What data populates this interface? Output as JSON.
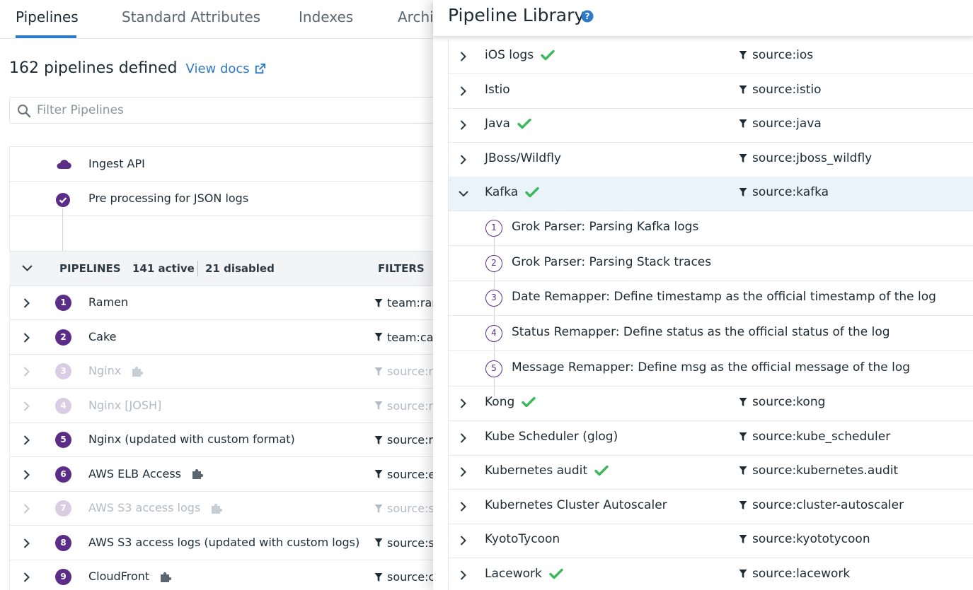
{
  "tabs": [
    {
      "label": "Pipelines",
      "active": true
    },
    {
      "label": "Standard Attributes",
      "active": false
    },
    {
      "label": "Indexes",
      "active": false
    },
    {
      "label": "Archi",
      "active": false
    }
  ],
  "summary": {
    "title": "162 pipelines defined",
    "docs_link": "View docs"
  },
  "filter": {
    "placeholder": "Filter Pipelines"
  },
  "preprocessing": [
    {
      "label": "Ingest API",
      "icon": "cloud-icon"
    },
    {
      "label": "Pre processing for JSON logs",
      "icon": "check-circle-icon"
    }
  ],
  "pipelines_header": {
    "title": "PIPELINES",
    "active": "141 active",
    "disabled": "21 disabled",
    "filters": "FILTERS"
  },
  "pipelines": [
    {
      "num": "1",
      "name": "Ramen",
      "filter": "team:ran",
      "disabled": false,
      "integration": false
    },
    {
      "num": "2",
      "name": "Cake",
      "filter": "team:cak",
      "disabled": false,
      "integration": false
    },
    {
      "num": "3",
      "name": "Nginx",
      "filter": "source:n",
      "disabled": true,
      "integration": true
    },
    {
      "num": "4",
      "name": "Nginx [JOSH]",
      "filter": "source:n",
      "disabled": true,
      "integration": false
    },
    {
      "num": "5",
      "name": "Nginx (updated with custom format)",
      "filter": "source:n",
      "disabled": false,
      "integration": false
    },
    {
      "num": "6",
      "name": "AWS ELB Access",
      "filter": "source:e",
      "disabled": false,
      "integration": true
    },
    {
      "num": "7",
      "name": "AWS S3 access logs",
      "filter": "source:s",
      "disabled": true,
      "integration": true
    },
    {
      "num": "8",
      "name": "AWS S3 access logs (updated with custom logs)",
      "filter": "source:s",
      "disabled": false,
      "integration": false
    },
    {
      "num": "9",
      "name": "CloudFront",
      "filter": "source:cl",
      "disabled": false,
      "integration": true
    }
  ],
  "library": {
    "title": "Pipeline Library",
    "items": [
      {
        "name": "iOS logs",
        "filter": "source:ios",
        "installed": true
      },
      {
        "name": "Istio",
        "filter": "source:istio",
        "installed": false
      },
      {
        "name": "Java",
        "filter": "source:java",
        "installed": true
      },
      {
        "name": "JBoss/Wildfly",
        "filter": "source:jboss_wildfly",
        "installed": false
      },
      {
        "name": "Kafka",
        "filter": "source:kafka",
        "installed": true,
        "expanded": true
      },
      {
        "name": "Kong",
        "filter": "source:kong",
        "installed": true
      },
      {
        "name": "Kube Scheduler (glog)",
        "filter": "source:kube_scheduler",
        "installed": false
      },
      {
        "name": "Kubernetes audit",
        "filter": "source:kubernetes.audit",
        "installed": true
      },
      {
        "name": "Kubernetes Cluster Autoscaler",
        "filter": "source:cluster-autoscaler",
        "installed": false
      },
      {
        "name": "KyotoTycoon",
        "filter": "source:kyototycoon",
        "installed": false
      },
      {
        "name": "Lacework",
        "filter": "source:lacework",
        "installed": true
      }
    ],
    "kafka_processors": [
      {
        "num": "1",
        "label": "Grok Parser: Parsing Kafka logs"
      },
      {
        "num": "2",
        "label": "Grok Parser: Parsing Stack traces"
      },
      {
        "num": "3",
        "label": "Date Remapper: Define timestamp as the official timestamp of the log"
      },
      {
        "num": "4",
        "label": "Status Remapper: Define status as the official status of the log"
      },
      {
        "num": "5",
        "label": "Message Remapper: Define msg as the official message of the log"
      }
    ]
  },
  "colors": {
    "brand_purple": "#5b2d86",
    "link_blue": "#2f7ac6",
    "installed_green": "#3bb85c"
  }
}
